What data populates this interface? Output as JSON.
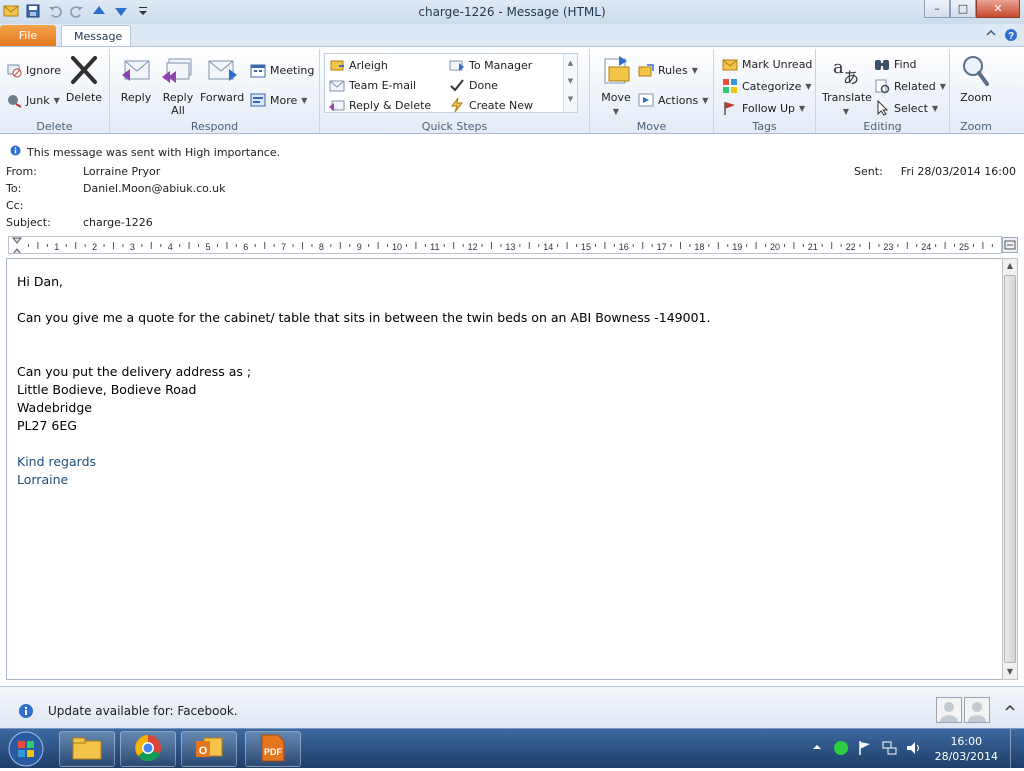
{
  "window": {
    "title": "charge-1226  -  Message (HTML)",
    "controls": {
      "minimize": "–",
      "maximize": "□",
      "close": "✕"
    }
  },
  "tabs": {
    "file": "File",
    "message": "Message"
  },
  "ribbon": {
    "delete": {
      "label": "Delete",
      "ignore": "Ignore",
      "junk": "Junk",
      "delete_btn": "Delete"
    },
    "respond": {
      "label": "Respond",
      "reply": "Reply",
      "reply_all_1": "Reply",
      "reply_all_2": "All",
      "forward": "Forward",
      "meeting": "Meeting",
      "more": "More"
    },
    "quick_steps": {
      "label": "Quick Steps",
      "items": [
        "Arleigh",
        "To Manager",
        "Team E-mail",
        "Done",
        "Reply & Delete",
        "Create New"
      ]
    },
    "move": {
      "label": "Move",
      "move_btn": "Move",
      "rules": "Rules",
      "actions": "Actions"
    },
    "tags": {
      "label": "Tags",
      "mark_unread": "Mark Unread",
      "categorize": "Categorize",
      "follow_up": "Follow Up"
    },
    "editing": {
      "label": "Editing",
      "translate": "Translate",
      "find": "Find",
      "related": "Related",
      "select": "Select"
    },
    "zoom": {
      "label": "Zoom",
      "zoom_btn": "Zoom"
    }
  },
  "header": {
    "importance": "This message was sent with High importance.",
    "from_label": "From:",
    "from": "Lorraine Pryor",
    "to_label": "To:",
    "to": "Daniel.Moon@abiuk.co.uk",
    "cc_label": "Cc:",
    "cc": "",
    "subject_label": "Subject:",
    "subject": "charge-1226",
    "sent_label": "Sent:",
    "sent": "Fri 28/03/2014 16:00"
  },
  "ruler": {
    "numbers": [
      "1",
      "2",
      "3",
      "4",
      "5",
      "6",
      "7",
      "8",
      "9",
      "10",
      "11",
      "12",
      "13",
      "14",
      "15",
      "16",
      "17",
      "18",
      "19",
      "20",
      "21",
      "22",
      "23",
      "24",
      "25"
    ]
  },
  "body": {
    "greeting": "Hi Dan,",
    "line1": "Can you give me a quote  for the cabinet/ table that sits in between the twin beds on an ABI Bowness -149001.",
    "line2": "Can you put the delivery address as ;",
    "address1": "Little Bodieve, Bodieve Road",
    "address2": "Wadebridge",
    "address3": "PL27 6EG",
    "sign1": "Kind regards",
    "sign2": "Lorraine"
  },
  "status": {
    "text": "Update available for: Facebook."
  },
  "taskbar": {
    "time": "16:00",
    "date": "28/03/2014"
  },
  "colors": {
    "accent_orange": "#e5761d",
    "signature_blue": "#1f4e79",
    "taskbar": "#1e3e68"
  }
}
